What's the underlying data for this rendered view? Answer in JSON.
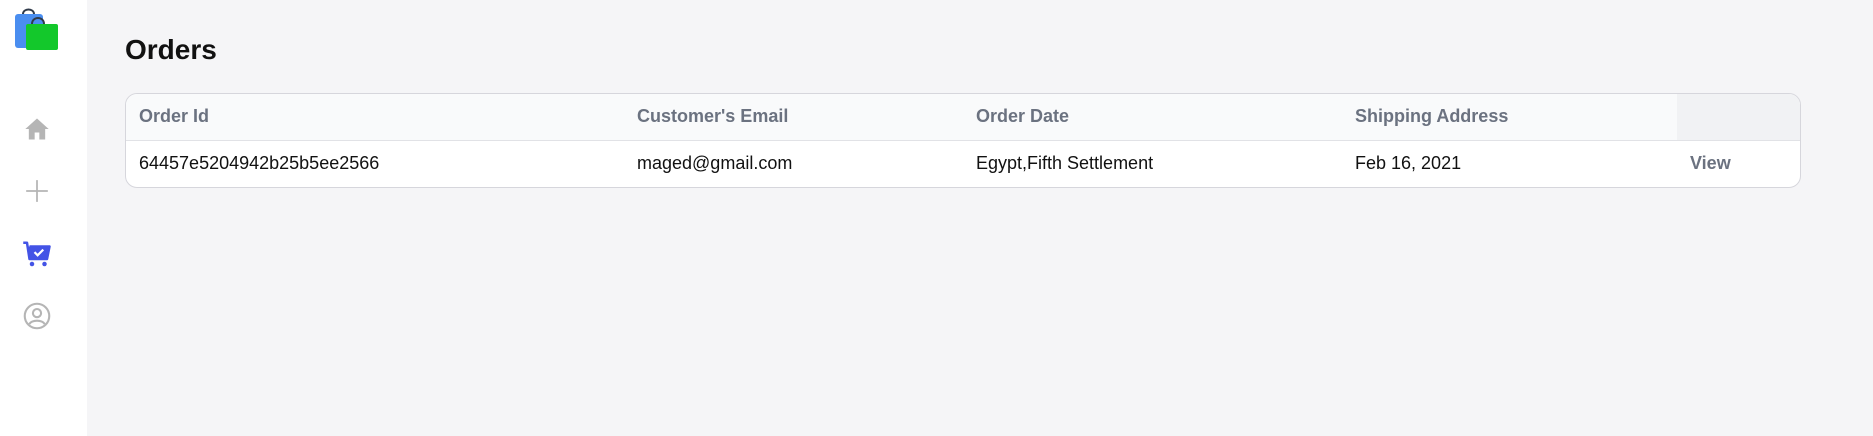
{
  "sidebar": {
    "items": [
      {
        "name": "home",
        "icon": "home-icon",
        "active": false
      },
      {
        "name": "add",
        "icon": "plus-icon",
        "active": false
      },
      {
        "name": "orders",
        "icon": "cart-check-icon",
        "active": true
      },
      {
        "name": "profile",
        "icon": "user-circle-icon",
        "active": false
      }
    ],
    "logo": "shopping-bags-logo"
  },
  "page": {
    "title": "Orders"
  },
  "table": {
    "headers": [
      "Order Id",
      "Customer's Email",
      "Order Date",
      "Shipping Address",
      ""
    ],
    "rows": [
      {
        "order_id": "64457e5204942b25b5ee2566",
        "email": "maged@gmail.com",
        "order_date": "Egypt,Fifth Settlement",
        "shipping_address": "Feb 16, 2021",
        "action": "View"
      }
    ]
  },
  "colors": {
    "accent": "#4353e6",
    "icon_muted": "#b5b5b5",
    "header_text": "#6b7280",
    "background": "#f5f5f7"
  }
}
